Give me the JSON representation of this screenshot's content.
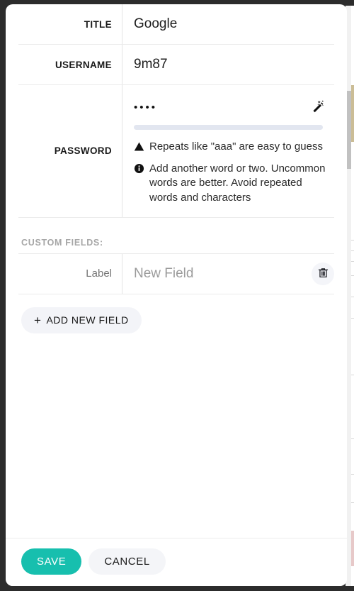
{
  "dialog": {
    "fields": [
      {
        "label": "TITLE",
        "value": "Google",
        "name": "title"
      },
      {
        "label": "USERNAME",
        "value": "9m87",
        "name": "username"
      }
    ],
    "password": {
      "label": "PASSWORD",
      "masked_value": "••••",
      "generate_icon": "magic-wand-icon",
      "strength_bar_color": "#e2e6f0",
      "hints": [
        {
          "icon": "warning-triangle-icon",
          "glyph": "▲",
          "text": "Repeats like \"aaa\" are easy to guess"
        },
        {
          "icon": "info-circle-icon",
          "glyph": "i",
          "text": "Add another word or two. Uncommon words are better. Avoid repeated words and characters"
        }
      ]
    },
    "custom_fields": {
      "section_label": "CUSTOM FIELDS:",
      "rows": [
        {
          "label_value": "",
          "label_placeholder": "Label",
          "value": "",
          "value_placeholder": "New Field",
          "delete_icon": "trash-icon"
        }
      ],
      "add_button": {
        "plus": "+",
        "label": "ADD NEW FIELD"
      }
    },
    "footer": {
      "save_label": "SAVE",
      "cancel_label": "CANCEL",
      "save_color": "#17bfae",
      "cancel_color": "#f4f5f8"
    }
  }
}
